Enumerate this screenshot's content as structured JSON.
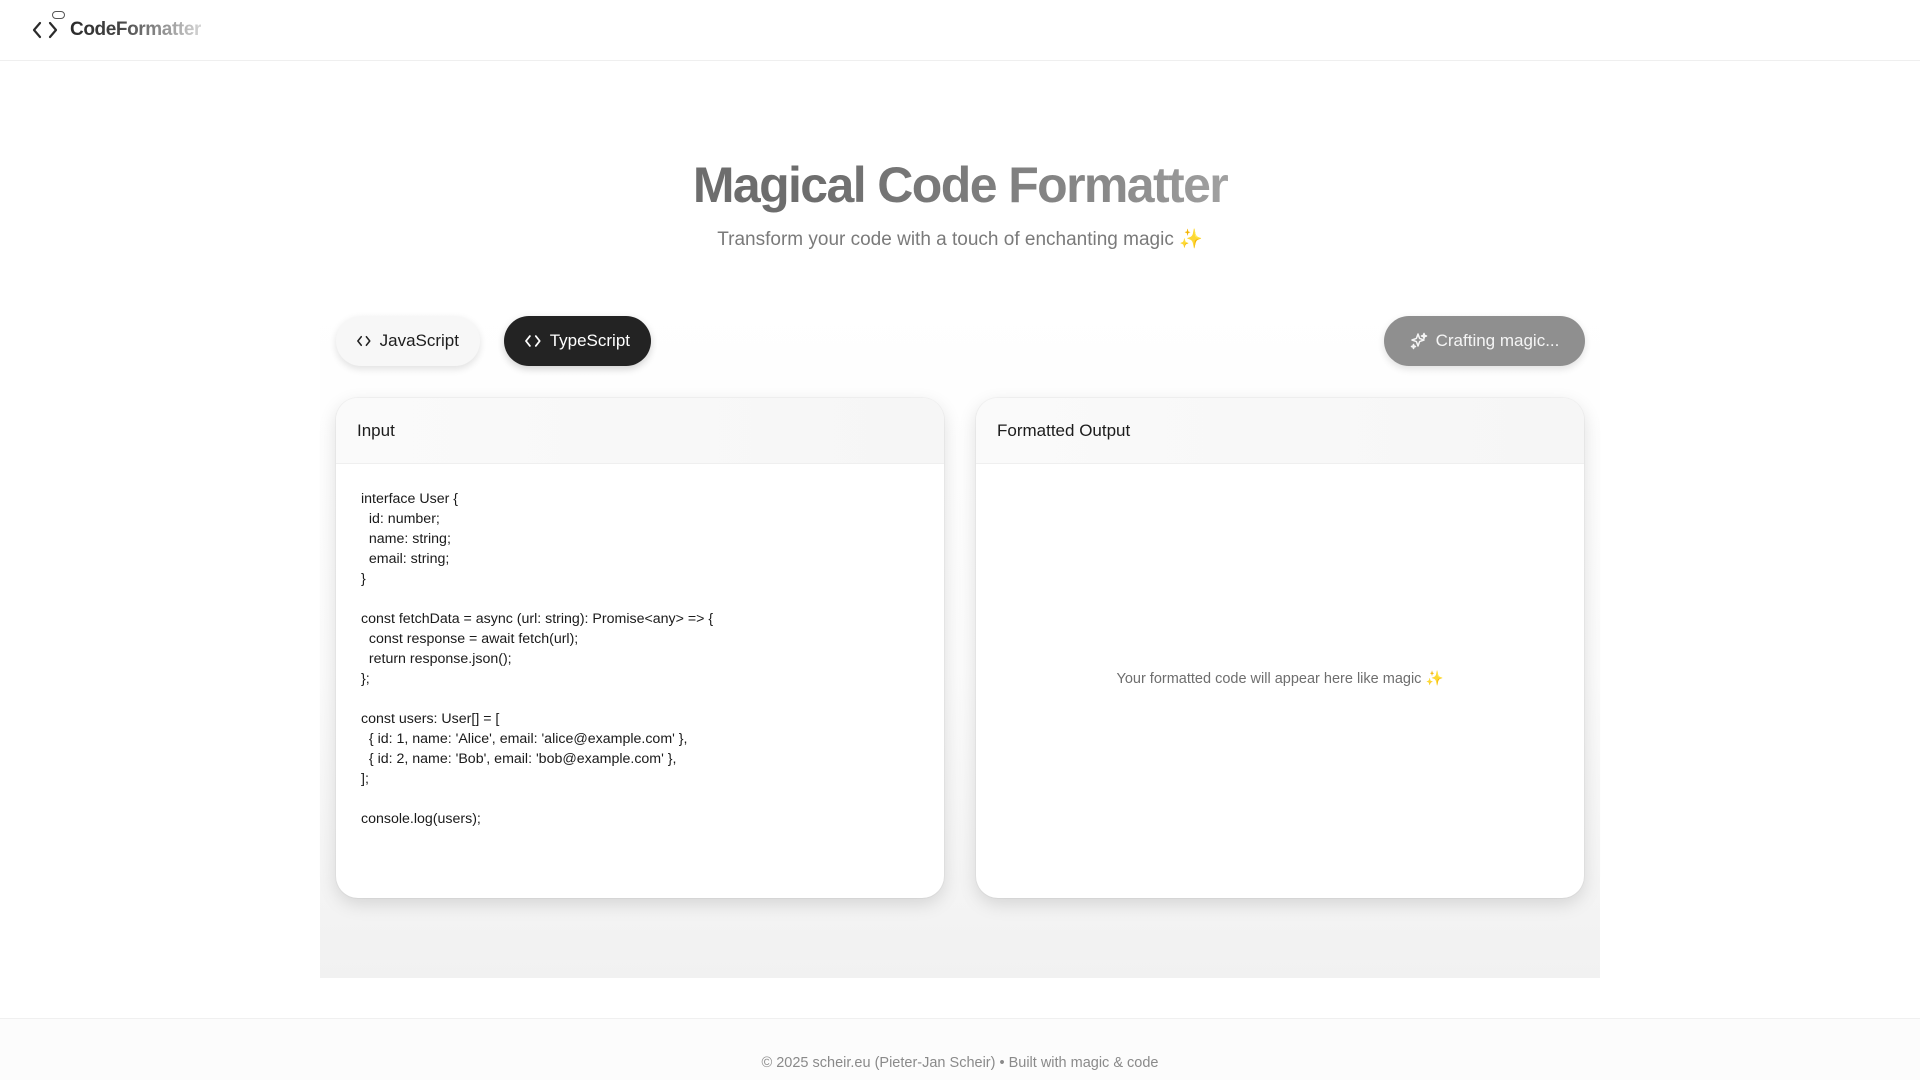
{
  "app": {
    "brand": "CodeFormatter",
    "brand_icon": "code-brackets-icon"
  },
  "hero": {
    "title": "Magical Code Formatter",
    "subtitle": "Transform your code with a touch of enchanting magic ✨"
  },
  "toolbar": {
    "languages": [
      {
        "label": "JavaScript",
        "icon": "code-brackets-icon",
        "selected": false
      },
      {
        "label": "TypeScript",
        "icon": "code-brackets-icon",
        "selected": true
      }
    ],
    "format_button": {
      "label": "Crafting magic...",
      "icon": "sparkles-icon",
      "state": "loading"
    }
  },
  "input_panel": {
    "title": "Input",
    "code": "interface User {\n  id: number;\n  name: string;\n  email: string;\n}\n\nconst fetchData = async (url: string): Promise<any> => {\n  const response = await fetch(url);\n  return response.json();\n};\n\nconst users: User[] = [\n  { id: 1, name: 'Alice', email: 'alice@example.com' },\n  { id: 2, name: 'Bob', email: 'bob@example.com' },\n];\n\nconsole.log(users);"
  },
  "output_panel": {
    "title": "Formatted Output",
    "placeholder": "Your formatted code will appear here like magic ✨"
  },
  "footer": {
    "text": "© 2025 scheir.eu (Pieter-Jan Scheir) • Built with magic & code"
  },
  "colors": {
    "selected_button": "#232323",
    "loading_button": "#8f8f8f",
    "background": "#ffffff"
  }
}
